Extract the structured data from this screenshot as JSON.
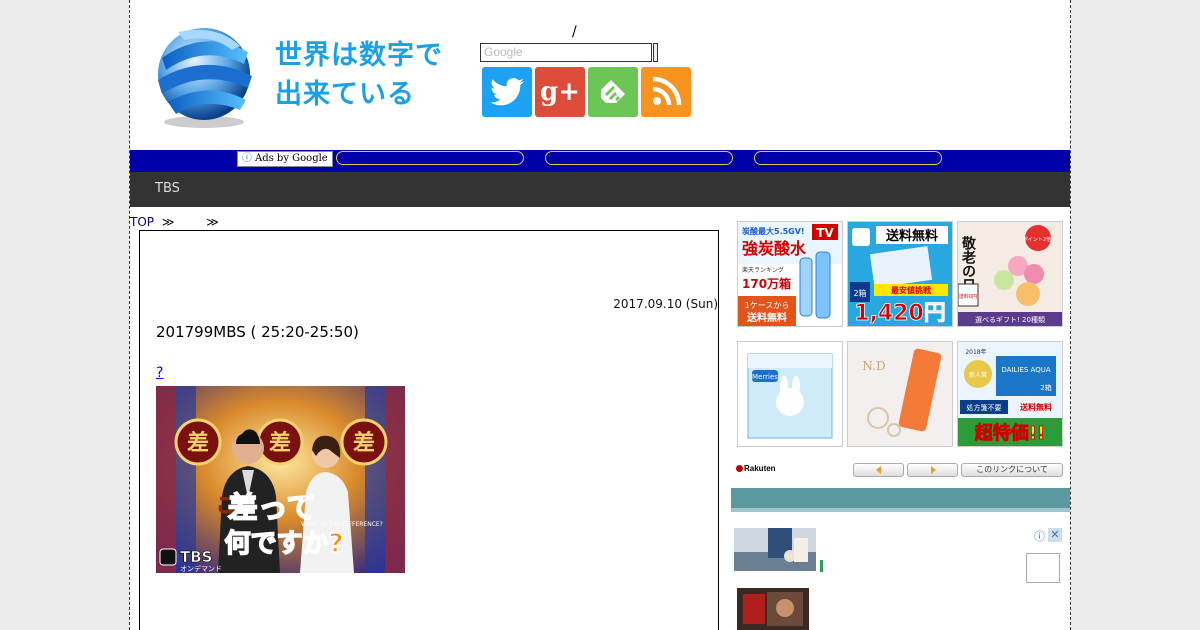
{
  "site": {
    "title_line1": "世界は数字で",
    "title_line2": "出来ている",
    "slash": "/",
    "search_placeholder": "Google"
  },
  "social": {
    "twitter": "twitter-icon",
    "googleplus_label": "g+",
    "feedly": "feedly-icon",
    "rss": "rss-icon"
  },
  "adsbar": {
    "label": "Ads by Google",
    "info_glyph": "ⓘ"
  },
  "nav": {
    "tbs": "TBS"
  },
  "breadcrumb": {
    "top": "TOP",
    "sep1": "≫",
    "sep2": "≫"
  },
  "article": {
    "date": "2017.09.10 (Sun)",
    "title": "201799MBS ( 25:20-25:50)",
    "question_link": "? "
  },
  "thumbnail": {
    "badge1": "差",
    "badge2": "差",
    "badge3": "差",
    "caption1": "この",
    "caption2": "差って",
    "caption3": "何ですか?",
    "sub": "WHAT IS THE DIFFERENCE?",
    "logo": "TBS",
    "logo_sub": "オンデマンド"
  },
  "banners": [
    {
      "top": "炭酸最大5.5GV!",
      "main": "強炭酸水",
      "tag": "TV",
      "rank": "楽天ランキング",
      "count": "170万箱",
      "bottom1": "1ケースから",
      "bottom2": "送料無料"
    },
    {
      "top": "送料無料",
      "badge": "2箱",
      "low": "最安値挑戦",
      "price": "1,420円"
    },
    {
      "title": "敬老の日",
      "point": "ポイント2倍!",
      "tag": "送料0円",
      "bottom": "選べるギフト! 20種類"
    },
    {
      "brand": "Merries"
    },
    {
      "brand": "N.D"
    },
    {
      "year": "2018年",
      "award": "新人賞",
      "brand": "DAILIES AQUA",
      "badge": "2箱",
      "special1": "処方箋不要",
      "special2": "送料無料",
      "price": "超特価!!"
    }
  ],
  "sidebar": {
    "rakuten": "Rakuten",
    "link_info": "このリンクについて",
    "ad_info": "ⓘ",
    "ad_close": "✕"
  },
  "colors": {
    "accent": "#1aa0e6",
    "adsbar": "#0000a8",
    "navbar": "#333333",
    "sidebar_header": "#5b98a0"
  }
}
